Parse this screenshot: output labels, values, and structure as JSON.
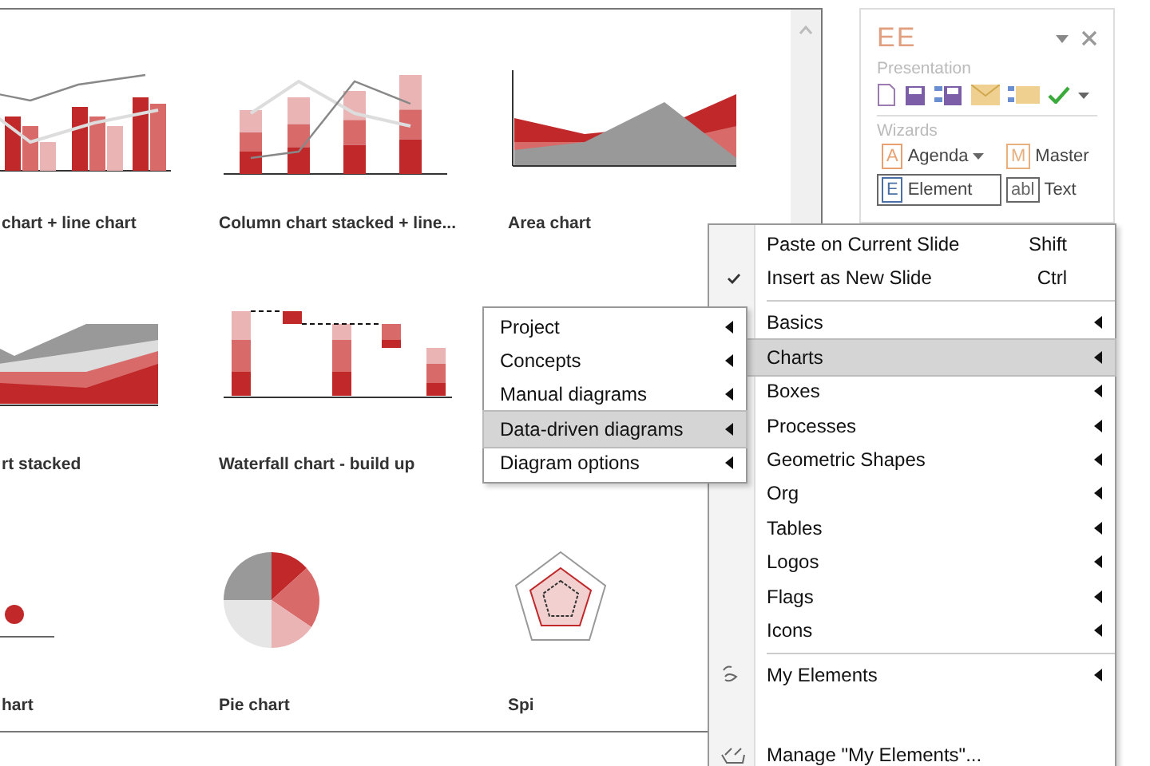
{
  "gallery": {
    "items": [
      {
        "title": "chart + line chart",
        "kind": "combo"
      },
      {
        "title": "Column chart stacked + line...",
        "kind": "stacked-line"
      },
      {
        "title": "Area chart",
        "kind": "area"
      },
      {
        "title": "rt stacked",
        "kind": "area-stacked"
      },
      {
        "title": "Waterfall chart - build up",
        "kind": "waterfall"
      },
      {
        "kind": "none"
      },
      {
        "title": "hart",
        "kind": "bubble"
      },
      {
        "title": "Pie chart",
        "kind": "pie"
      },
      {
        "title": "Spi",
        "kind": "spider"
      }
    ]
  },
  "panel": {
    "title": "EE",
    "groups": [
      {
        "label": "Presentation",
        "kind": "icons"
      },
      {
        "label": "Wizards",
        "kind": "buttons",
        "buttons": [
          {
            "letter": "A",
            "label": "Agenda",
            "color": "#e8a070",
            "dropdown": true,
            "selected": false
          },
          {
            "letter": "M",
            "label": "Master",
            "color": "#e8b080",
            "dropdown": false,
            "selected": false
          },
          {
            "letter": "E",
            "label": "Element",
            "color": "#4a6fa5",
            "dropdown": false,
            "selected": true
          },
          {
            "letter": "abl",
            "label": "Text",
            "color": "#666666",
            "dropdown": false,
            "selected": false
          }
        ]
      }
    ]
  },
  "context_menu": {
    "groups": [
      [
        {
          "label": "Paste on Current Slide",
          "shortcut": "Shift",
          "checked": false,
          "submenu": false,
          "selected": false,
          "kind": "item"
        },
        {
          "label": "Insert as New Slide",
          "shortcut": "Ctrl",
          "checked": true,
          "submenu": false,
          "selected": false,
          "kind": "item"
        }
      ],
      [
        {
          "label": "Basics",
          "submenu": true,
          "selected": false,
          "kind": "item"
        },
        {
          "label": "Charts",
          "submenu": true,
          "selected": true,
          "kind": "item"
        },
        {
          "label": "Boxes",
          "submenu": true,
          "selected": false,
          "kind": "item"
        },
        {
          "label": "Processes",
          "submenu": true,
          "selected": false,
          "kind": "item"
        },
        {
          "label": "Geometric Shapes",
          "submenu": true,
          "selected": false,
          "kind": "item"
        },
        {
          "label": "Org",
          "submenu": true,
          "selected": false,
          "kind": "item"
        },
        {
          "label": "Tables",
          "submenu": true,
          "selected": false,
          "kind": "item"
        },
        {
          "label": "Logos",
          "submenu": true,
          "selected": false,
          "kind": "item"
        },
        {
          "label": "Flags",
          "submenu": true,
          "selected": false,
          "kind": "item"
        },
        {
          "label": "Icons",
          "submenu": true,
          "selected": false,
          "kind": "item"
        }
      ],
      [
        {
          "label": "My Elements",
          "submenu": true,
          "selected": false,
          "kind": "my"
        },
        {
          "label": "Manage \"My Elements\"...",
          "submenu": false,
          "selected": false,
          "kind": "manage"
        }
      ]
    ]
  },
  "submenu": {
    "items": [
      {
        "label": "Project",
        "selected": false
      },
      {
        "label": "Concepts",
        "selected": false
      },
      {
        "label": "Manual diagrams",
        "selected": false
      },
      {
        "label": "Data-driven diagrams",
        "selected": true
      },
      {
        "label": "Diagram options",
        "selected": false
      }
    ]
  }
}
